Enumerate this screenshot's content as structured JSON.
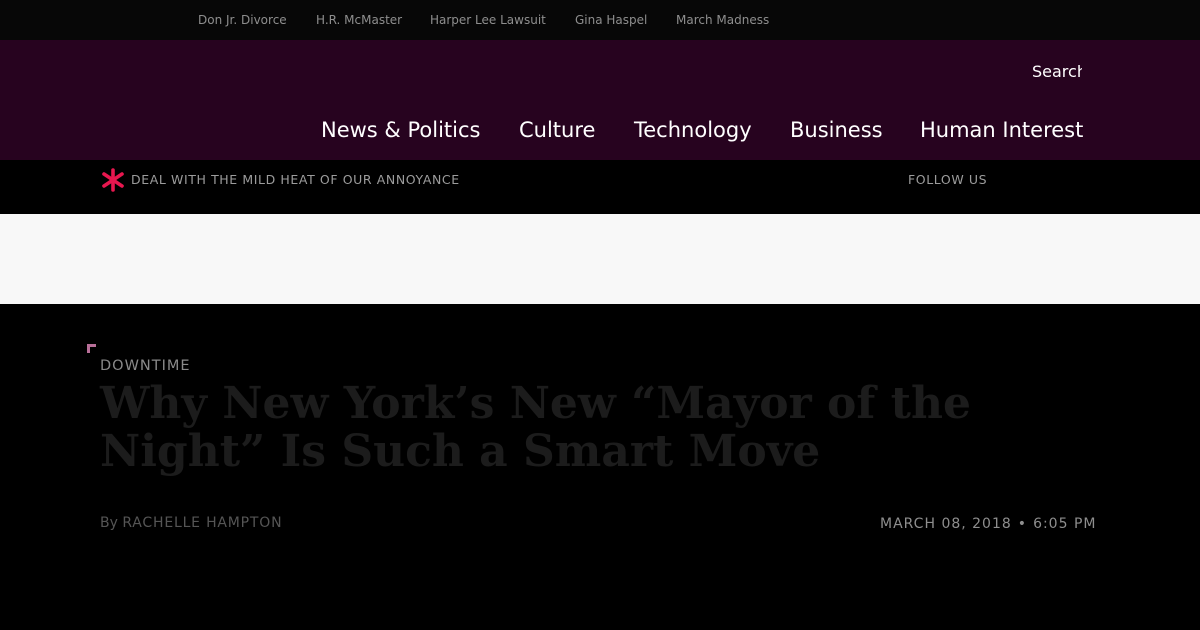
{
  "trending": {
    "items": [
      "Don Jr. Divorce",
      "H.R. McMaster",
      "Harper Lee Lawsuit",
      "Gina Haspel",
      "March Madness"
    ]
  },
  "masthead": {
    "search_label": "Search",
    "nav": [
      "News & Politics",
      "Culture",
      "Technology",
      "Business",
      "Human Interest"
    ]
  },
  "tagline_bar": {
    "logo_icon": "asterisk-logo-icon",
    "tagline": "DEAL WITH THE MILD HEAT OF OUR ANNOYANCE",
    "follow_label": "FOLLOW US"
  },
  "article": {
    "kicker": "DOWNTIME",
    "headline": "Why New York’s New “Mayor of the Night” Is Such a Smart Move",
    "byline_prefix": "By",
    "author": "RACHELLE HAMPTON",
    "date": "MARCH 08, 2018",
    "date_separator": "•",
    "time": "6:05 PM",
    "corner_icon": "corner-bracket-icon"
  },
  "colors": {
    "masthead_bg": "#27031f",
    "brand_accent": "#e8174f",
    "top_bar_bg": "#070707",
    "ad_slot_bg": "#f8f8f8"
  }
}
